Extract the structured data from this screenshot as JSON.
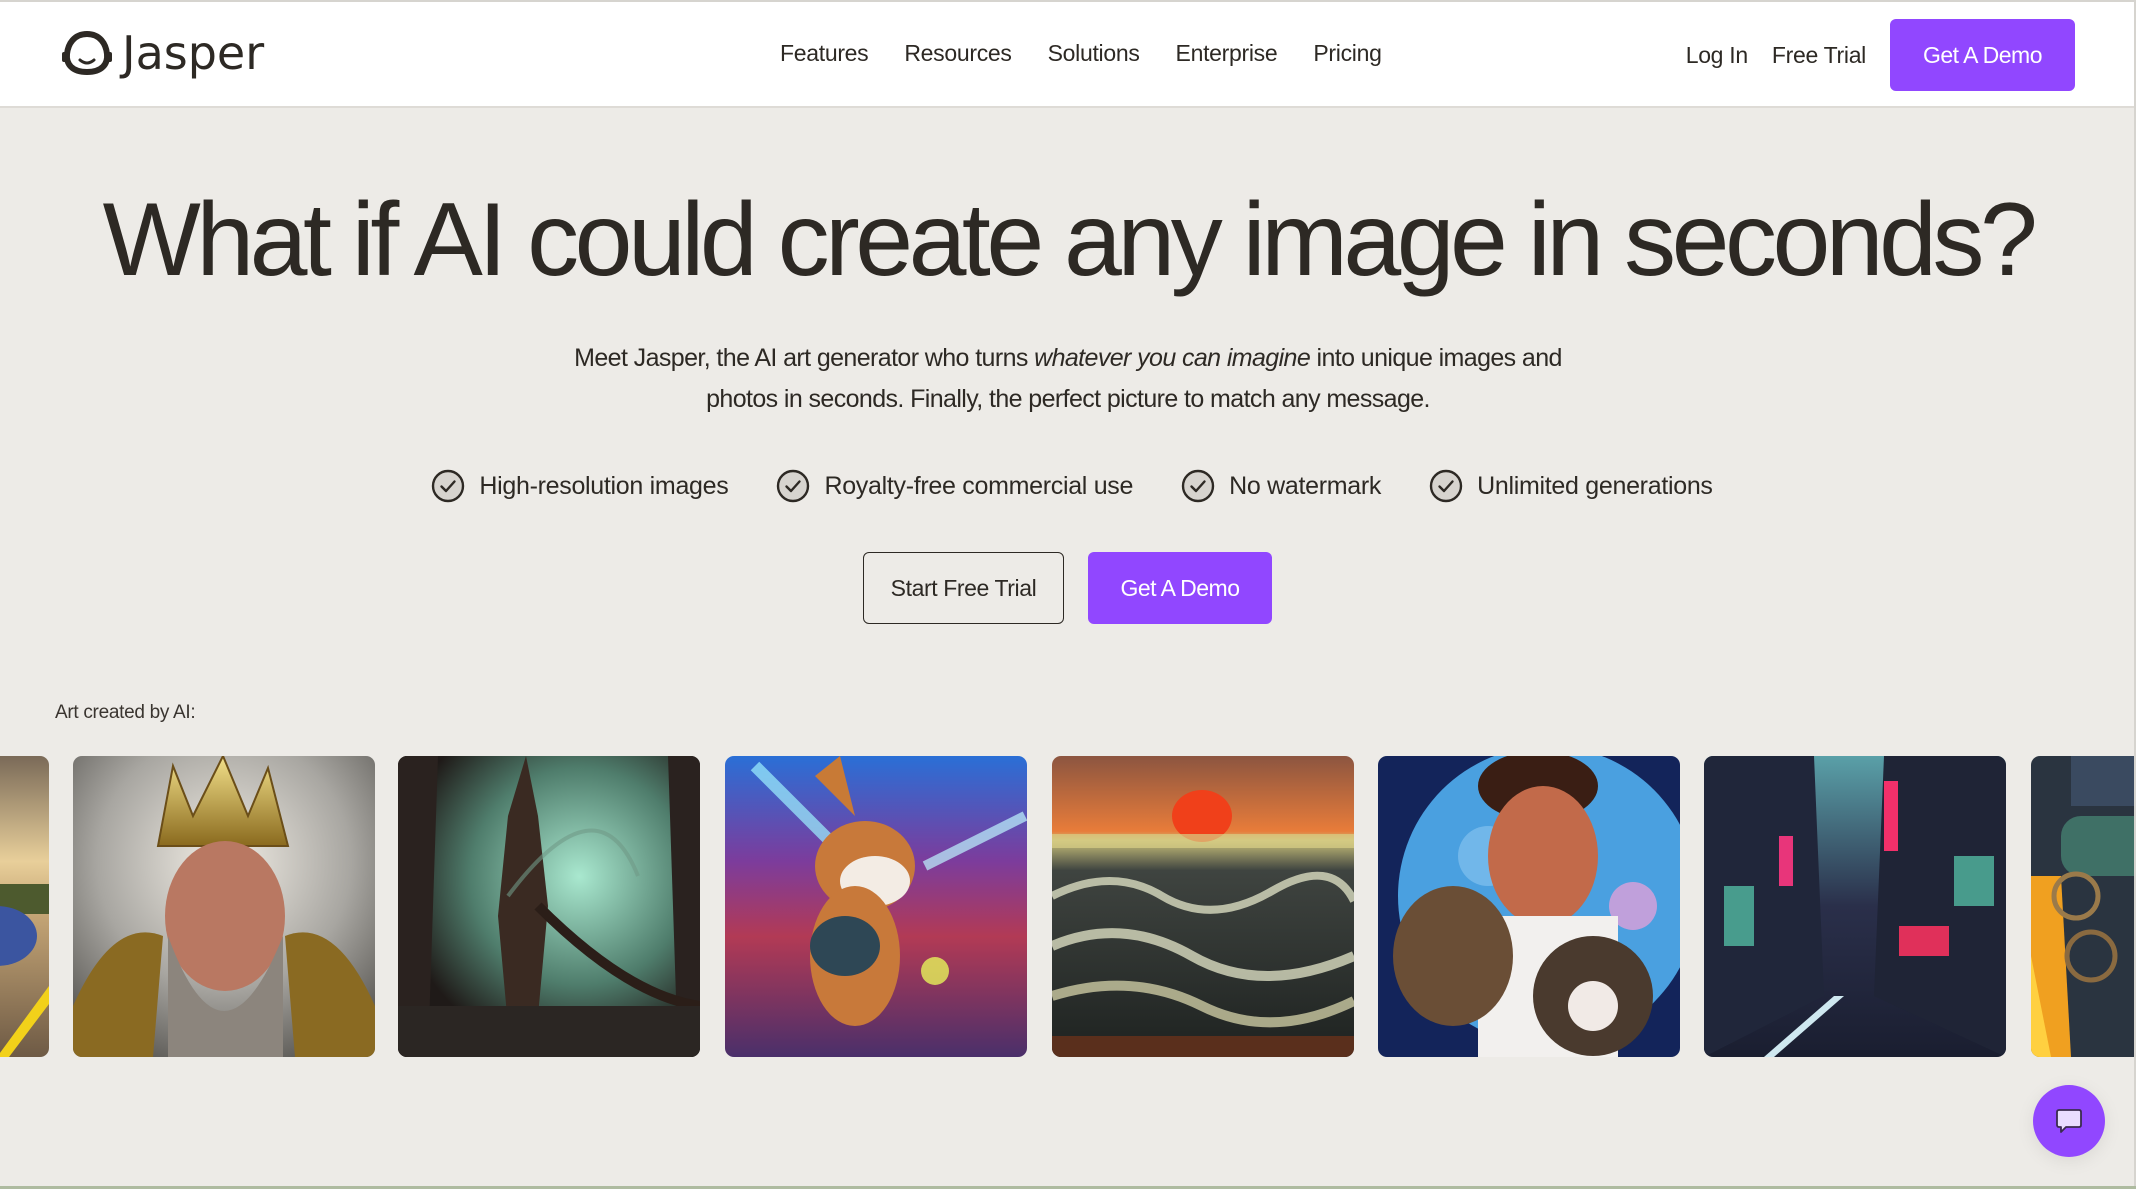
{
  "header": {
    "brand": "Jasper",
    "nav": [
      {
        "label": "Features"
      },
      {
        "label": "Resources"
      },
      {
        "label": "Solutions"
      },
      {
        "label": "Enterprise"
      },
      {
        "label": "Pricing"
      }
    ],
    "login_label": "Log In",
    "free_trial_label": "Free Trial",
    "demo_label": "Get A Demo"
  },
  "hero": {
    "headline": "What if AI could create any image in seconds?",
    "subtitle_before": "Meet Jasper, the AI art generator who turns ",
    "subtitle_emphasis": "whatever you can imagine",
    "subtitle_after": " into unique images and photos in seconds. Finally, the perfect picture to match any message.",
    "features": [
      {
        "label": "High-resolution images",
        "icon": "check-circle-icon"
      },
      {
        "label": "Royalty-free commercial use",
        "icon": "check-circle-icon"
      },
      {
        "label": "No watermark",
        "icon": "check-circle-icon"
      },
      {
        "label": "Unlimited generations",
        "icon": "check-circle-icon"
      }
    ],
    "cta_primary": "Get A Demo",
    "cta_secondary": "Start Free Trial"
  },
  "gallery": {
    "label": "Art created by AI:",
    "images": [
      {
        "subject": "blue car on sunlit road",
        "partial": true
      },
      {
        "subject": "bearded king with golden crown"
      },
      {
        "subject": "dark creature with blade in misty forest"
      },
      {
        "subject": "corgi running through neon city"
      },
      {
        "subject": "ocean waves under red sunset"
      },
      {
        "subject": "man holding two kittens in front of moon"
      },
      {
        "subject": "rainy neon cyberpunk street"
      },
      {
        "subject": "ornate celtic knot portrait with fire",
        "partial": true
      }
    ]
  },
  "chat": {
    "icon": "chat-bubble-icon"
  },
  "colors": {
    "brand_purple": "#9147ff",
    "background": "#edebe7",
    "text": "#2d2924"
  }
}
